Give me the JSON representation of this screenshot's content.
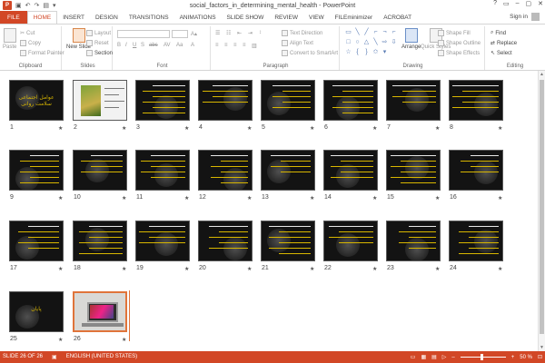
{
  "window": {
    "title": "social_factors_in_determining_mental_health - PowerPoint",
    "app_icon": "P",
    "controls": [
      "?",
      "▭",
      "–",
      "▢",
      "✕"
    ]
  },
  "tabs": {
    "file": "FILE",
    "items": [
      "HOME",
      "INSERT",
      "DESIGN",
      "TRANSITIONS",
      "ANIMATIONS",
      "SLIDE SHOW",
      "REVIEW",
      "VIEW",
      "FILEminimizer",
      "ACROBAT"
    ],
    "active": "HOME",
    "signin": "Sign in"
  },
  "ribbon": {
    "clipboard": {
      "label": "Clipboard",
      "paste": "Paste",
      "cut": "Cut",
      "copy": "Copy",
      "format_painter": "Format Painter"
    },
    "slides": {
      "label": "Slides",
      "new_slide": "New Slide",
      "layout": "Layout",
      "reset": "Reset",
      "section": "Section"
    },
    "font": {
      "label": "Font"
    },
    "paragraph": {
      "label": "Paragraph",
      "text_direction": "Text Direction",
      "align_text": "Align Text",
      "convert": "Convert to SmartArt"
    },
    "drawing": {
      "label": "Drawing",
      "arrange": "Arrange",
      "quick_styles": "Quick Styles",
      "shape_fill": "Shape Fill",
      "shape_outline": "Shape Outline",
      "shape_effects": "Shape Effects"
    },
    "editing": {
      "label": "Editing",
      "find": "Find",
      "replace": "Replace",
      "select": "Select"
    }
  },
  "slides": [
    {
      "num": "1",
      "kind": "title",
      "title": "عوامل اجتماعی سلامت روانی"
    },
    {
      "num": "2",
      "kind": "photo"
    },
    {
      "num": "3",
      "kind": "text"
    },
    {
      "num": "4",
      "kind": "text"
    },
    {
      "num": "5",
      "kind": "text"
    },
    {
      "num": "6",
      "kind": "text"
    },
    {
      "num": "7",
      "kind": "text"
    },
    {
      "num": "8",
      "kind": "text"
    },
    {
      "num": "9",
      "kind": "text"
    },
    {
      "num": "10",
      "kind": "text"
    },
    {
      "num": "11",
      "kind": "text"
    },
    {
      "num": "12",
      "kind": "text"
    },
    {
      "num": "13",
      "kind": "text"
    },
    {
      "num": "14",
      "kind": "text"
    },
    {
      "num": "15",
      "kind": "text"
    },
    {
      "num": "16",
      "kind": "text"
    },
    {
      "num": "17",
      "kind": "text"
    },
    {
      "num": "18",
      "kind": "text"
    },
    {
      "num": "19",
      "kind": "text"
    },
    {
      "num": "20",
      "kind": "text"
    },
    {
      "num": "21",
      "kind": "text"
    },
    {
      "num": "22",
      "kind": "text"
    },
    {
      "num": "23",
      "kind": "text"
    },
    {
      "num": "24",
      "kind": "text"
    },
    {
      "num": "25",
      "kind": "title",
      "title": "پایان"
    },
    {
      "num": "26",
      "kind": "laptop"
    }
  ],
  "star_glyph": "★",
  "status": {
    "slide_info": "SLIDE 26 OF 26",
    "language": "ENGLISH (UNITED STATES)",
    "zoom": "50 %",
    "zoom_level": 0.5,
    "selected_slide": "26"
  },
  "colors": {
    "accent": "#d24726",
    "selection": "#e0743a",
    "slide_bg": "#131313",
    "slide_text": "#d8b600"
  }
}
